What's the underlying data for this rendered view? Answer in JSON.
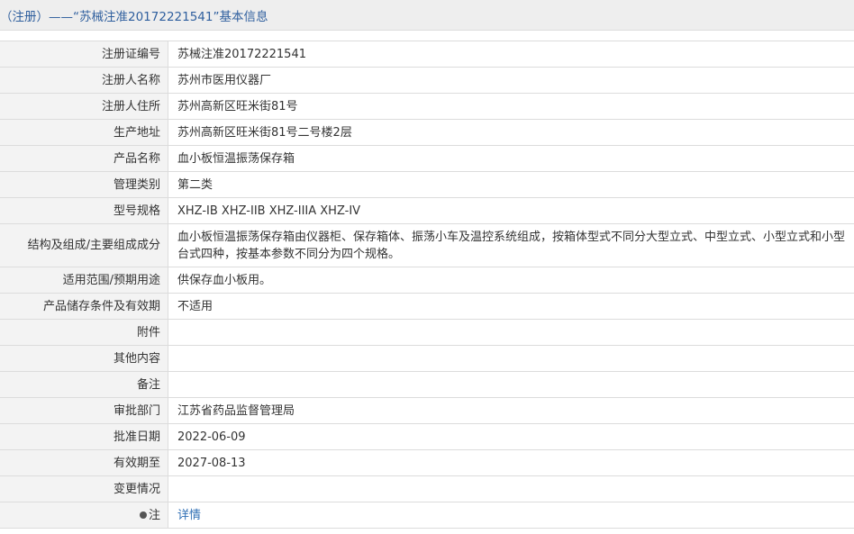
{
  "header": {
    "title": "（注册）——“苏械注准20172221541”基本信息"
  },
  "rows": [
    {
      "label": "注册证编号",
      "value": "苏械注准20172221541"
    },
    {
      "label": "注册人名称",
      "value": "苏州市医用仪器厂"
    },
    {
      "label": "注册人住所",
      "value": "苏州高新区旺米街81号"
    },
    {
      "label": "生产地址",
      "value": "苏州高新区旺米街81号二号楼2层"
    },
    {
      "label": "产品名称",
      "value": "血小板恒温振荡保存箱"
    },
    {
      "label": "管理类别",
      "value": "第二类"
    },
    {
      "label": "型号规格",
      "value": "XHZ-IB XHZ-IIB XHZ-IIIA XHZ-IV"
    },
    {
      "label": "结构及组成/主要组成成分",
      "value": "血小板恒温振荡保存箱由仪器柜、保存箱体、振荡小车及温控系统组成，按箱体型式不同分大型立式、中型立式、小型立式和小型台式四种，按基本参数不同分为四个规格。"
    },
    {
      "label": "适用范围/预期用途",
      "value": "供保存血小板用。"
    },
    {
      "label": "产品储存条件及有效期",
      "value": "不适用"
    },
    {
      "label": "附件",
      "value": ""
    },
    {
      "label": "其他内容",
      "value": ""
    },
    {
      "label": "备注",
      "value": ""
    },
    {
      "label": "审批部门",
      "value": "江苏省药品监督管理局"
    },
    {
      "label": "批准日期",
      "value": "2022-06-09"
    },
    {
      "label": "有效期至",
      "value": "2027-08-13"
    },
    {
      "label": "变更情况",
      "value": ""
    },
    {
      "label": "注",
      "value": "详情",
      "icon": "location-pin-icon"
    }
  ]
}
